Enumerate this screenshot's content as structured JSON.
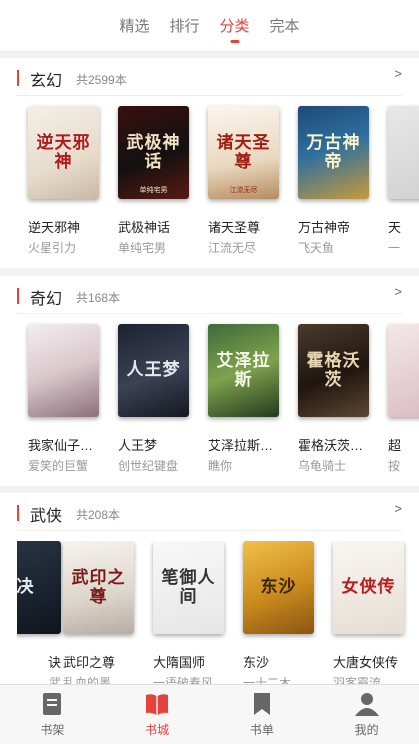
{
  "tabs": [
    {
      "label": "精选",
      "active": false
    },
    {
      "label": "排行",
      "active": false
    },
    {
      "label": "分类",
      "active": true
    },
    {
      "label": "完本",
      "active": false
    }
  ],
  "sections": [
    {
      "title": "玄幻",
      "count": "共2599本",
      "more": ">",
      "books": [
        {
          "name": "逆天邪神",
          "author": "火星引力",
          "cover_text": "逆天邪神",
          "cover_sub": "",
          "bg": "linear-gradient(160deg,#f4efe6,#e7dccb 60%,#c9b9a4)",
          "fg": "#b0191c"
        },
        {
          "name": "武极神话",
          "author": "单纯宅男",
          "cover_text": "武极神话",
          "cover_sub": "单纯宅男",
          "bg": "linear-gradient(160deg,#3a0f10,#141010 55%,#5a1a14)",
          "fg": "#f2e2c8"
        },
        {
          "name": "诸天圣尊",
          "author": "江流无尽",
          "cover_text": "诸天圣尊",
          "cover_sub": "江流无尽",
          "bg": "linear-gradient(170deg,#fbf6ee,#e9d8bf 60%,#b58b5f)",
          "fg": "#a01d14"
        },
        {
          "name": "万古神帝",
          "author": "飞天鱼",
          "cover_text": "万古神帝",
          "cover_sub": "",
          "bg": "linear-gradient(160deg,#1f4a77,#2e6f9e 45%,#c79a3c)",
          "fg": "#fff3c9"
        },
        {
          "name": "天",
          "author": "一",
          "cover_text": "",
          "cover_sub": "",
          "bg": "linear-gradient(160deg,#e8e8e8,#cfcfcf)",
          "fg": "#333"
        }
      ]
    },
    {
      "title": "奇幻",
      "count": "共168本",
      "more": ">",
      "books": [
        {
          "name": "我家仙子…",
          "author": "爱笑的巨蟹",
          "cover_text": "",
          "cover_sub": "",
          "bg": "linear-gradient(160deg,#f3eef0,#d9c7cc 50%,#8c6f7a)",
          "fg": "#333"
        },
        {
          "name": "人王梦",
          "author": "创世纪键盘",
          "cover_text": "人王梦",
          "cover_sub": "",
          "bg": "linear-gradient(160deg,#1c2231,#3b4254 55%,#141820)",
          "fg": "#e8e8ef"
        },
        {
          "name": "艾泽拉斯…",
          "author": "瞧你",
          "cover_text": "艾泽拉斯",
          "cover_sub": "",
          "bg": "linear-gradient(160deg,#3f6a3a,#7fa24f 50%,#233a1d)",
          "fg": "#f4f8e6"
        },
        {
          "name": "霍格沃茨…",
          "author": "乌龟骑士",
          "cover_text": "霍格沃茨",
          "cover_sub": "",
          "bg": "linear-gradient(160deg,#4a3a2c,#20160f 55%,#5c4633)",
          "fg": "#e9d6b3"
        },
        {
          "name": "超",
          "author": "按",
          "cover_text": "",
          "cover_sub": "",
          "bg": "linear-gradient(160deg,#f3e8ea,#d9b9bf)",
          "fg": "#c0262c"
        }
      ]
    },
    {
      "title": "武侠",
      "count": "共208本",
      "more": ">",
      "books": [
        {
          "name": "诀",
          "author": "武",
          "cover_text": "决",
          "cover_sub": "",
          "bg": "linear-gradient(160deg,#2a3646,#0f151e)",
          "fg": "#e6ecf2"
        },
        {
          "name": "武印之尊",
          "author": "乱血的墨",
          "cover_text": "武印之尊",
          "cover_sub": "",
          "bg": "linear-gradient(170deg,#f6f3ee,#dcd5cb 60%,#b7ada2)",
          "fg": "#7a1a18"
        },
        {
          "name": "大隋国师",
          "author": "一语破春风",
          "cover_text": "笔御人间",
          "cover_sub": "",
          "bg": "linear-gradient(170deg,#f8f8f8,#e6e6e6)",
          "fg": "#333"
        },
        {
          "name": "东沙",
          "author": "一十二木",
          "cover_text": "东沙",
          "cover_sub": "",
          "bg": "linear-gradient(160deg,#f2c04a,#c98a1e 55%,#8a5512)",
          "fg": "#3a2205"
        },
        {
          "name": "大唐女侠传",
          "author": "羽客霞流",
          "cover_text": "女侠传",
          "cover_sub": "",
          "bg": "linear-gradient(170deg,#f8f6f2,#e7ded3)",
          "fg": "#b81d1d"
        }
      ]
    }
  ],
  "bottom_nav": [
    {
      "label": "书架",
      "icon": "bookshelf-icon",
      "active": false
    },
    {
      "label": "书城",
      "icon": "bookstore-icon",
      "active": true
    },
    {
      "label": "书单",
      "icon": "booklist-icon",
      "active": false
    },
    {
      "label": "我的",
      "icon": "profile-icon",
      "active": false
    }
  ],
  "colors": {
    "accent": "#e4433b",
    "icon_gray": "#666666"
  }
}
